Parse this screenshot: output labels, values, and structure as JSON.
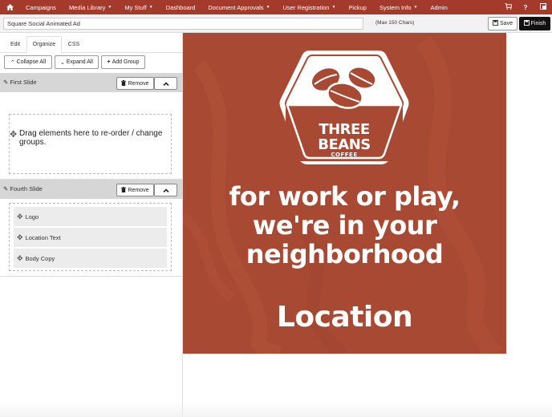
{
  "nav": {
    "items": [
      {
        "label": "Campaigns",
        "caret": false
      },
      {
        "label": "Media Library",
        "caret": true
      },
      {
        "label": "My Stuff",
        "caret": true
      },
      {
        "label": "Dashboard",
        "caret": false
      },
      {
        "label": "Document Approvals",
        "caret": true
      },
      {
        "label": "User Registration",
        "caret": true
      },
      {
        "label": "Pickup",
        "caret": false
      },
      {
        "label": "System Info",
        "caret": true
      },
      {
        "label": "Admin",
        "caret": false
      }
    ],
    "help_label": "?"
  },
  "titlebar": {
    "title_value": "Square Social Animated Ad",
    "max_chars": "(Max 150 Chars)",
    "save_label": "Save",
    "finish_label": "Finish"
  },
  "tabs": {
    "edit": "Edit",
    "organize": "Organize",
    "css": "CSS",
    "active": "organize"
  },
  "toolbar": {
    "collapse_all": "Collapse All",
    "expand_all": "Expand All",
    "add_group": "Add Group"
  },
  "slides": [
    {
      "title": "First Slide",
      "remove_label": "Remove",
      "dropzone_text": "Drag elements here to re-order / change groups.",
      "elements": []
    },
    {
      "title": "Fourth Slide",
      "remove_label": "Remove",
      "elements": [
        "Logo",
        "Location Text",
        "Body Copy"
      ]
    }
  ],
  "ad": {
    "brand_line1": "THREE",
    "brand_line2": "BEANS",
    "brand_line3": "COFFEE",
    "tagline_1": "for work or play,",
    "tagline_2": "we're in your",
    "tagline_3": "neighborhood",
    "location": "Location",
    "background_color": "#a84a33"
  },
  "colors": {
    "nav_bg": "#a33a2c",
    "finish_bg": "#111111"
  },
  "icons": {
    "home": "home-icon",
    "cart": "cart-icon",
    "help": "help-icon",
    "user": "user-switch-icon",
    "save": "floppy-icon",
    "move": "move-icon",
    "trash": "trash-icon"
  }
}
